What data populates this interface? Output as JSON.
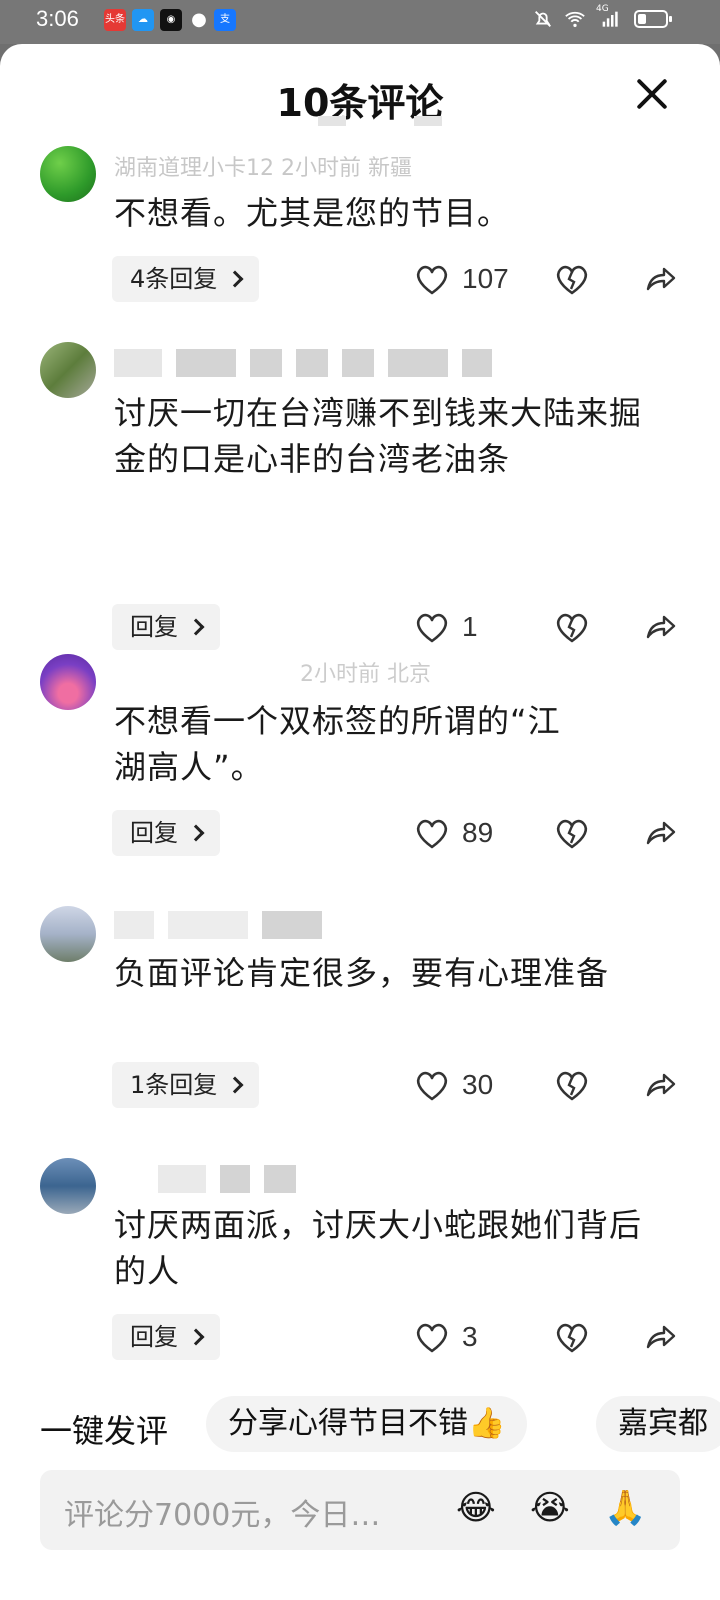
{
  "status_bar": {
    "time": "3:06",
    "network": "4G",
    "notif_toutiao": "头条"
  },
  "sheet": {
    "title": "10条评论",
    "close_icon": "close-icon"
  },
  "comments": [
    {
      "meta": "湖南道理小卡12  2小时前  新疆",
      "text": "不想看。尤其是您的节目。",
      "reply_label": "4条回复",
      "likes": "107"
    },
    {
      "meta": "",
      "text": "讨厌一切在台湾赚不到钱来大陆来掘金的口是心非的台湾老油条",
      "reply_label": "回复",
      "likes": "1"
    },
    {
      "meta": "2小时前  北京",
      "text": "不想看一个双标签的所谓的“江湖高人”。",
      "reply_label": "回复",
      "likes": "89"
    },
    {
      "meta": "",
      "text": "负面评论肯定很多，要有心理准备",
      "reply_label": "1条回复",
      "likes": "30"
    },
    {
      "meta": "",
      "text": "讨厌两面派，讨厌大小蛇跟她们背后的人",
      "reply_label": "回复",
      "likes": "3"
    }
  ],
  "quick_reply": {
    "label": "一键发评",
    "chips": [
      "分享心得节目不错👍",
      "嘉宾都"
    ]
  },
  "input": {
    "placeholder": "评论分7000元，今日…",
    "emojis": [
      "😂",
      "😭",
      "🙏"
    ]
  }
}
